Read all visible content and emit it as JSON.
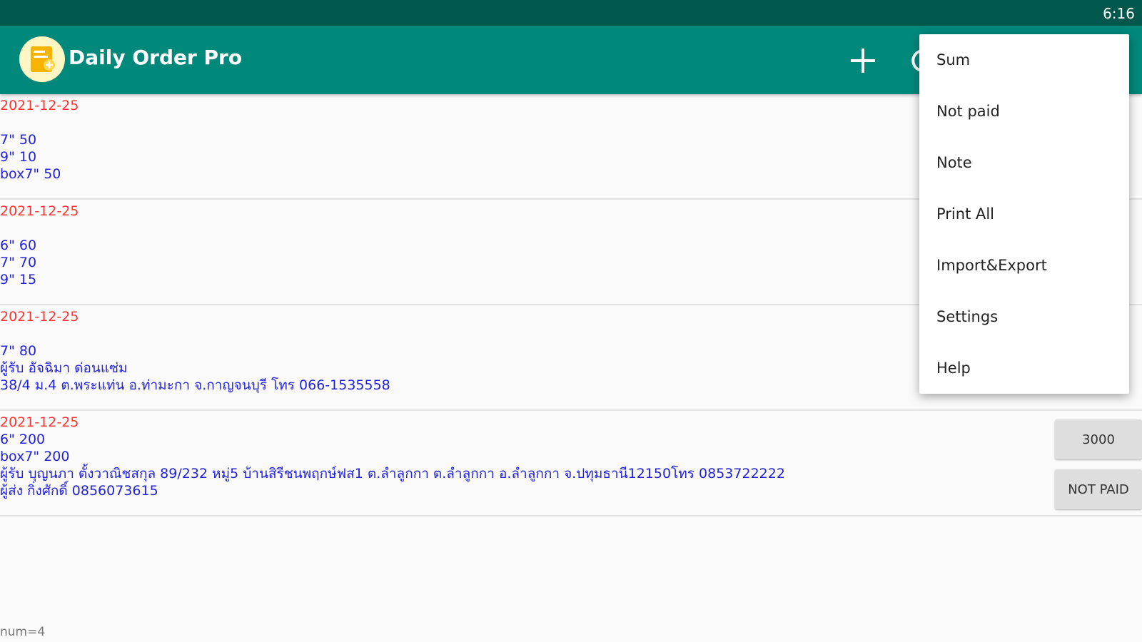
{
  "status_bar": {
    "time": "6:16"
  },
  "app_bar": {
    "title": "Daily Order Pro",
    "logo_icon": "receipt-logo-icon",
    "add_icon": "plus-icon",
    "sync_icon": "refresh-icon"
  },
  "orders": [
    {
      "date": "2021-12-25",
      "lines": [
        "7\" 50",
        "9\" 10",
        "box7\" 50"
      ]
    },
    {
      "date": "2021-12-25",
      "lines": [
        "6\" 60",
        "7\" 70",
        "9\" 15"
      ]
    },
    {
      "date": "2021-12-25",
      "lines": [
        "7\" 80",
        "ผู้รับ อัจฉิมา ด่อนแซ่ม",
        "38/4 ม.4 ต.พระแท่น อ.ท่ามะกา จ.กาญจนบุรี โทร 066-1535558"
      ]
    },
    {
      "date": "2021-12-25",
      "lines": [
        "6\" 200",
        "box7\" 200",
        "ผู้รับ บุญนภา ตั้งวาณิชสกุล 89/232 หมู่5 บ้านสิรีชนพฤกษ์ฟส1 ต.ลำลูกกา ต.ลำลูกกา อ.ลำลูกกา จ.ปทุมธานี12150โทร 0853722222",
        "ผู้ส่ง กิ่งศักดิ์ 0856073615"
      ]
    }
  ],
  "order4_buttons": {
    "sum": "3000",
    "status": "NOT PAID"
  },
  "footer": {
    "count": "num=4"
  },
  "menu": {
    "items": [
      "Sum",
      "Not paid",
      "Note",
      "Print All",
      "Import&Export",
      "Settings",
      "Help"
    ]
  },
  "colors": {
    "primary": "#00897b",
    "primary_dark": "#00574b",
    "date": "#ff3333",
    "text": "#2222dd"
  }
}
